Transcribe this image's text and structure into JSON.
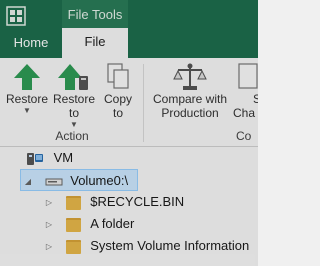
{
  "tabs": {
    "contextual_header": "File Tools",
    "home": "Home",
    "file": "File"
  },
  "ribbon": {
    "restore": {
      "label": "Restore",
      "has_dropdown": true
    },
    "restore_to": {
      "label": "Restore to",
      "has_dropdown": true
    },
    "copy_to": {
      "label1": "Copy",
      "label2": "to"
    },
    "compare": {
      "label1": "Compare with",
      "label2": "Production"
    },
    "partial_label1": "S",
    "partial_label2": "Cha",
    "group_action": "Action",
    "group_partial": "Co"
  },
  "tree": {
    "root": "VM",
    "volume": "Volume0:\\",
    "folders": [
      "$RECYCLE.BIN",
      "A folder",
      "System Volume Information"
    ]
  },
  "colors": {
    "titlebar": "#1e6e4d",
    "accent_green": "#2e9b55",
    "selection": "#cde8ff"
  }
}
